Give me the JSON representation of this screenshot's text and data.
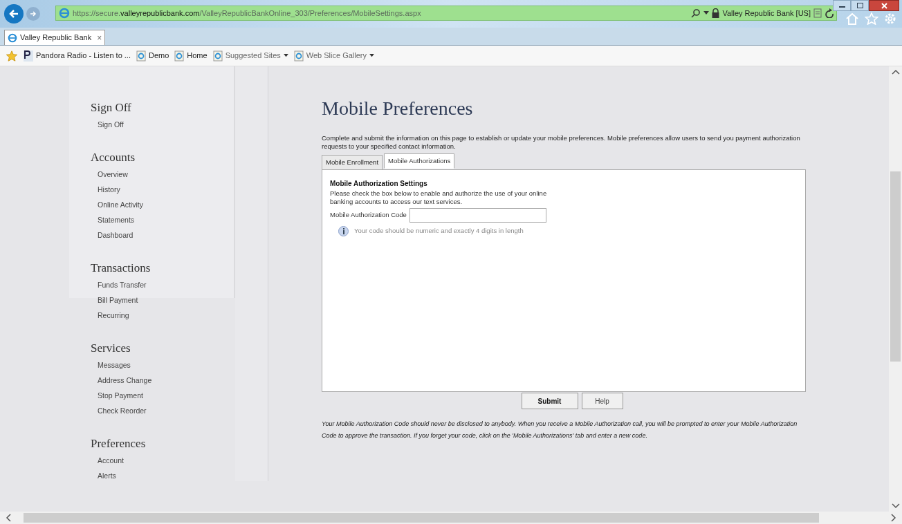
{
  "browser": {
    "url_host_prefix": "https://secure.",
    "url_host": "valleyrepublicbank.com",
    "url_path": "/ValleyRepublicBankOnline_303/Preferences/MobileSettings.aspx",
    "site_identity": "Valley Republic Bank [US]",
    "tab_title": "Valley Republic Bank",
    "tab_close": "×",
    "favorites": [
      {
        "label": "Pandora Radio - Listen to ...",
        "kind": "pandora",
        "dropdown": false
      },
      {
        "label": "Demo",
        "kind": "page",
        "dropdown": false
      },
      {
        "label": "Home",
        "kind": "page",
        "dropdown": false
      },
      {
        "label": "Suggested Sites",
        "kind": "page",
        "dropdown": true
      },
      {
        "label": "Web Slice Gallery",
        "kind": "page",
        "dropdown": true
      }
    ]
  },
  "sidebar": [
    {
      "heading": "Sign Off",
      "items": [
        "Sign Off"
      ]
    },
    {
      "heading": "Accounts",
      "items": [
        "Overview",
        "History",
        "Online Activity",
        "Statements",
        "Dashboard"
      ]
    },
    {
      "heading": "Transactions",
      "items": [
        "Funds Transfer",
        "Bill Payment",
        "Recurring"
      ]
    },
    {
      "heading": "Services",
      "items": [
        "Messages",
        "Address Change",
        "Stop Payment",
        "Check Reorder"
      ]
    },
    {
      "heading": "Preferences",
      "items": [
        "Account",
        "Alerts"
      ]
    }
  ],
  "main": {
    "title": "Mobile Preferences",
    "intro": "Complete and submit the information on this page to establish or update your mobile preferences. Mobile preferences allow users to send you payment authorization requests to your specified contact information.",
    "tabs": [
      {
        "label": "Mobile Enrollment",
        "selected": false
      },
      {
        "label": "Mobile Authorizations",
        "selected": true
      }
    ],
    "panel": {
      "heading": "Mobile Authorization Settings",
      "description": "Please check the box below to enable and authorize the use of your online banking accounts to access our text services.",
      "field_label": "Mobile Authorization Code",
      "hint": "Your code should be numeric and exactly 4 digits in length"
    },
    "buttons": [
      "Submit",
      "Help"
    ],
    "footnote": "Your Mobile Authorization Code should never be disclosed to anybody. When you receive a Mobile Authorization call, you will be prompted to enter your Mobile Authorization Code to approve the transaction. If you forget your code, click on the 'Mobile Authorizations' tab and enter a new code."
  }
}
